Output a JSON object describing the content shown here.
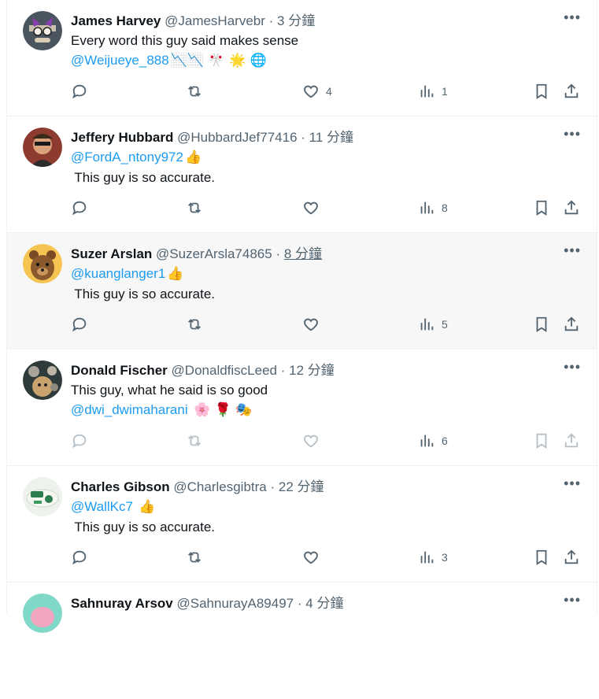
{
  "tweets": [
    {
      "name": "James Harvey",
      "handle": "@JamesHarvebr",
      "time": "3 分鐘",
      "lines": [
        {
          "text": "Every word this guy said makes sense",
          "mention": "",
          "emoji": ""
        },
        {
          "text": "",
          "mention": "@Weijueye_888",
          "emoji": "📉📉 🎌 🌟 🌐"
        }
      ],
      "likes": "4",
      "views": "1",
      "avatar_color": "#5a4d3f"
    },
    {
      "name": "Jeffery Hubbard",
      "handle": "@HubbardJef77416",
      "time": "11 分鐘",
      "lines": [
        {
          "text": "",
          "mention": "@FordA_ntony972",
          "emoji": "👍"
        },
        {
          "text": " This guy is so accurate.",
          "mention": "",
          "emoji": ""
        }
      ],
      "likes": "",
      "views": "8",
      "avatar_color": "#7a2a2a"
    },
    {
      "name": "Suzer Arslan",
      "handle": "@SuzerArsla74865",
      "time": "8 分鐘",
      "lines": [
        {
          "text": "",
          "mention": "@kuanglanger1",
          "emoji": "👍"
        },
        {
          "text": " This guy is so accurate.",
          "mention": "",
          "emoji": ""
        }
      ],
      "likes": "",
      "views": "5",
      "avatar_color": "#f2c14e"
    },
    {
      "name": "Donald Fischer",
      "handle": "@DonaldfiscLeed",
      "time": "12 分鐘",
      "lines": [
        {
          "text": "This guy, what he said is so good",
          "mention": "",
          "emoji": ""
        },
        {
          "text": "",
          "mention": "@dwi_dwimaharani",
          "emoji": " 🌸 🌹 🎭"
        }
      ],
      "likes": "",
      "views": "6",
      "avatar_color": "#2c3e50"
    },
    {
      "name": "Charles Gibson",
      "handle": "@Charlesgibtra",
      "time": "22 分鐘",
      "lines": [
        {
          "text": "",
          "mention": "@WallKc7",
          "emoji": " 👍"
        },
        {
          "text": " This guy is so accurate.",
          "mention": "",
          "emoji": ""
        }
      ],
      "likes": "",
      "views": "3",
      "avatar_color": "#e8efe6"
    },
    {
      "name": "Sahnuray Arsov",
      "handle": "@SahnurayA89497",
      "time": "4 分鐘",
      "lines": [],
      "likes": "",
      "views": "",
      "avatar_color": "#7fd8c8"
    }
  ]
}
